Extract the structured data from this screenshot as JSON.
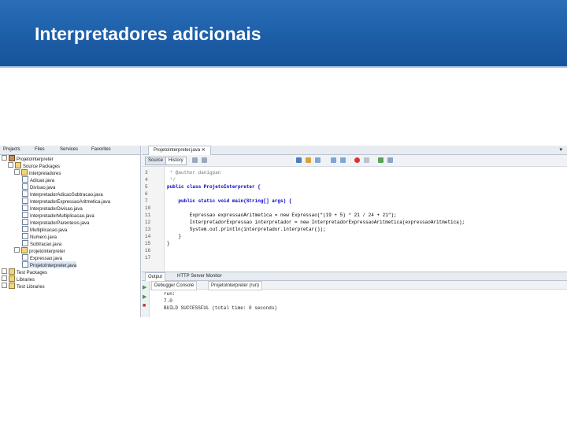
{
  "slide": {
    "title": "Interpretadores adicionais"
  },
  "left_panel": {
    "tabs": [
      "Projects",
      "Files",
      "Services",
      "Favorites"
    ],
    "tree": [
      "ProjetoInterpreter",
      "Source Packages",
      "interpretadores",
      "Adicao.java",
      "Divisao.java",
      "InterpretadorAdicaoSubtracao.java",
      "InterpretadorExpressaoAritmetica.java",
      "InterpretadorDivisao.java",
      "InterpretadorMultiplicacao.java",
      "InterpretadorParentesis.java",
      "Multiplicacao.java",
      "Numero.java",
      "Subtracao.java",
      "projetointerpreter",
      "Expressao.java",
      "ProjetoInterpreter.java",
      "Test Packages",
      "Libraries",
      "Test Libraries"
    ]
  },
  "editor": {
    "tab": "ProjetoInterpreter.java",
    "toolbar": {
      "source": "Source",
      "history": "History"
    },
    "line_numbers": [
      "3",
      "4",
      "5",
      "6",
      "7",
      "10",
      "11",
      "12",
      "13",
      "14",
      "15",
      "16",
      "17"
    ],
    "lines": [
      " * @author danigpan",
      " */",
      "public class ProjetoInterpreter {",
      "",
      "    public static void main(String[] args) {",
      "",
      "        Expressao expressaoAritmetica = new Expressao(\"(19 + 5) * 21 / 24 + 21\");",
      "        InterpretadorExpressao interpretador = new InterpretadorExpressaoAritmetica(expressaoAritmetica);",
      "        System.out.println(interpretador.interpretar());",
      "    }",
      "}",
      "",
      ""
    ]
  },
  "output": {
    "tabs": [
      "Output",
      "HTTP Server Monitor"
    ],
    "subtabs": [
      "Debugger Console",
      "ProjetoInterpreter (run)"
    ],
    "lines": [
      "run:",
      "7.0",
      "BUILD SUCCESSFUL (total time: 0 seconds)"
    ]
  }
}
